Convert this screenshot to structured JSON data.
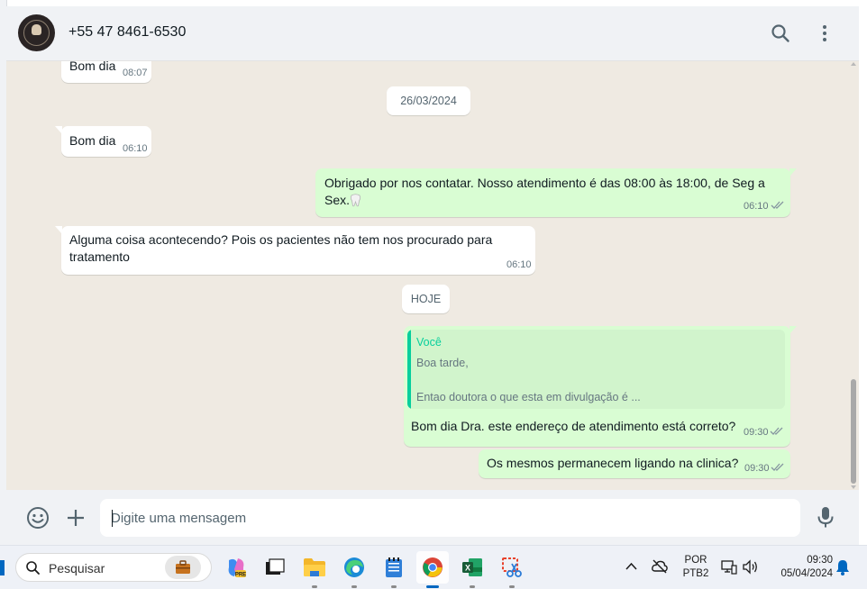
{
  "header": {
    "contact_name": "+55 47 8461-6530",
    "icons": [
      "avatar",
      "search-icon",
      "menu-dots-icon"
    ]
  },
  "chat": {
    "messages": [
      {
        "direction": "in",
        "text": "Bom dia",
        "time": "08:07"
      },
      {
        "type": "date",
        "text": "26/03/2024"
      },
      {
        "direction": "in",
        "text": "Bom dia",
        "time": "06:10"
      },
      {
        "direction": "out",
        "text_line1": "Obrigado por nos contatar. Nosso atendimento é das 08:00 às 18:00, de Seg a",
        "text_line2": "Sex.",
        "emoji": "tooth",
        "time": "06:10",
        "status": "read"
      },
      {
        "direction": "in",
        "text_line1": "Alguma coisa acontecendo? Pois os pacientes não tem nos procurado para",
        "text_line2": "tratamento",
        "time": "06:10"
      },
      {
        "type": "date",
        "text": "HOJE"
      },
      {
        "direction": "out",
        "quote": {
          "author": "Você",
          "line1": "Boa tarde,",
          "line2": "Entao doutora o que esta em divulgação é ..."
        },
        "text": "Bom dia Dra. este endereço de atendimento está correto?",
        "time": "09:30",
        "status": "read"
      },
      {
        "direction": "out",
        "text": "Os mesmos permanecem ligando na clinica?",
        "time": "09:30",
        "status": "read"
      }
    ]
  },
  "composer": {
    "placeholder": "Digite uma mensagem",
    "icons": [
      "emoji-icon",
      "plus-icon",
      "mic-icon"
    ]
  },
  "taskbar": {
    "search_label": "Pesquisar",
    "apps": [
      "briefcase",
      "copilot",
      "task-view",
      "file-explorer",
      "edge",
      "notepad",
      "chrome",
      "excel",
      "snipping-tool"
    ],
    "active_app": "chrome",
    "lang_line1": "POR",
    "lang_line2": "PTB2",
    "time": "09:30",
    "date": "05/04/2024",
    "accent": "#0067c0"
  },
  "colors": {
    "chat_bg": "#efeae2",
    "incoming_bubble": "#ffffff",
    "outgoing_bubble": "#d9fdd3",
    "read_ticks": "#8696a0",
    "quote_author": "#06cf9c"
  }
}
